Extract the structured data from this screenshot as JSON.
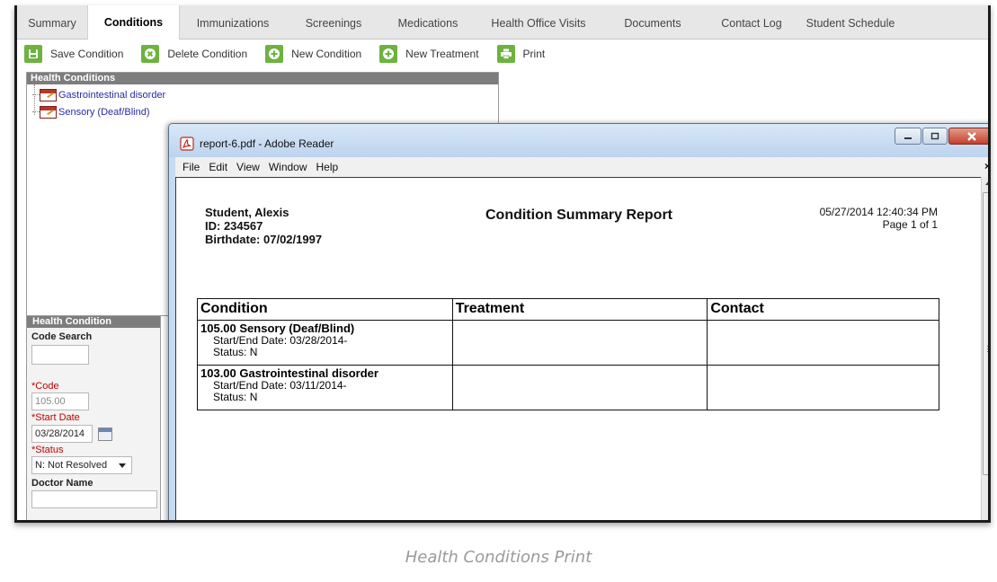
{
  "tabs": [
    {
      "label": "Summary",
      "active": false
    },
    {
      "label": "Conditions",
      "active": true
    },
    {
      "label": "Immunizations",
      "active": false
    },
    {
      "label": "Screenings",
      "active": false
    },
    {
      "label": "Medications",
      "active": false
    },
    {
      "label": "Health Office Visits",
      "active": false
    },
    {
      "label": "Documents",
      "active": false
    },
    {
      "label": "Contact Log",
      "active": false
    },
    {
      "label": "Student Schedule",
      "active": false
    }
  ],
  "toolbar": {
    "save": "Save Condition",
    "delete": "Delete Condition",
    "new_condition": "New Condition",
    "new_treatment": "New Treatment",
    "print": "Print",
    "icon_color": "#6cb33f"
  },
  "health_conditions": {
    "header": "Health Conditions",
    "items": [
      {
        "label": "Gastrointestinal disorder"
      },
      {
        "label": "Sensory (Deaf/Blind)"
      }
    ]
  },
  "form": {
    "header": "Health Condition",
    "code_search_label": "Code Search",
    "code_search_value": "",
    "code_label": "*Code",
    "code_value": "105.00",
    "start_date_label": "*Start Date",
    "start_date_value": "03/28/2014",
    "status_label": "*Status",
    "status_value": "N: Not Resolved",
    "doctor_label": "Doctor Name",
    "doctor_value": ""
  },
  "reader": {
    "title": "report-6.pdf - Adobe Reader",
    "menu": [
      "File",
      "Edit",
      "View",
      "Window",
      "Help"
    ],
    "close_glyph": "×"
  },
  "report": {
    "student_name": "Student, Alexis",
    "student_id": "ID: 234567",
    "birthdate": "Birthdate: 07/02/1997",
    "title": "Condition Summary Report",
    "timestamp": "05/27/2014 12:40:34 PM",
    "page": "Page 1 of 1",
    "columns": [
      "Condition",
      "Treatment",
      "Contact"
    ],
    "rows": [
      {
        "condition": "105.00 Sensory (Deaf/Blind)",
        "dates": "Start/End Date: 03/28/2014-",
        "status": "Status: N",
        "treatment": "",
        "contact": ""
      },
      {
        "condition": "103.00 Gastrointestinal disorder",
        "dates": "Start/End Date: 03/11/2014-",
        "status": "Status: N",
        "treatment": "",
        "contact": ""
      }
    ]
  },
  "caption": "Health Conditions Print"
}
